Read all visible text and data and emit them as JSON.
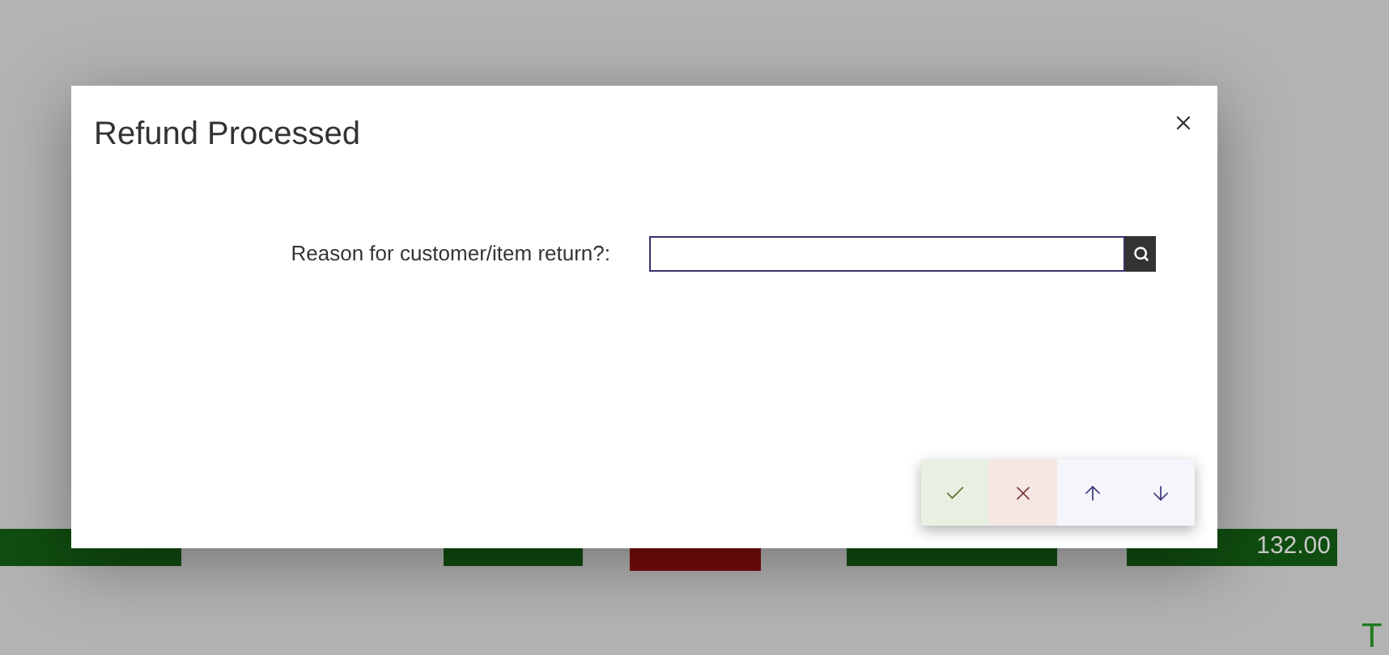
{
  "background": {
    "cells": [
      {
        "kind": "positive"
      },
      {
        "kind": "positive"
      },
      {
        "kind": "negative"
      },
      {
        "kind": "positive"
      },
      {
        "text": "132.00",
        "kind": "positive"
      }
    ],
    "footer_text": "T"
  },
  "dialog": {
    "title": "Refund Processed",
    "field": {
      "label": "Reason for customer/item return?:"
    },
    "actions": [
      {
        "kind": "confirm"
      },
      {
        "kind": "cancel"
      },
      {
        "kind": "up"
      },
      {
        "kind": "down"
      }
    ]
  }
}
